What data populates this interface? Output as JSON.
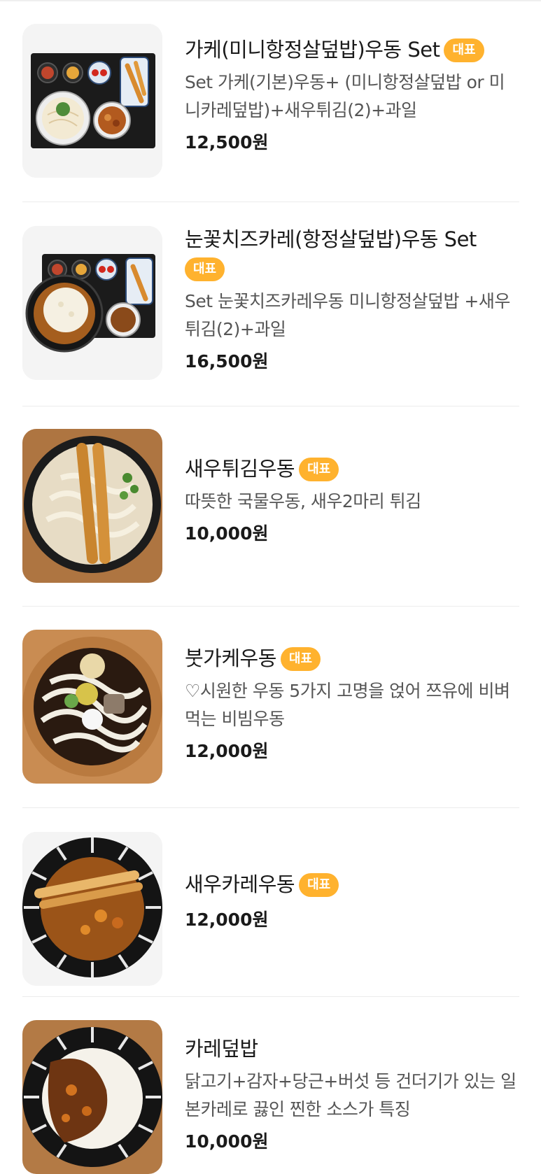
{
  "menu": {
    "items": [
      {
        "name": "가케(미니항정살덮밥)우동 Set",
        "badge": "대표",
        "description": "Set 가케(기본)우동+ (미니항정살덮밥 or 미니카레덮밥)+새우튀김(2)+과일",
        "price": "12,500원",
        "image_icon": "set-tray-food-image"
      },
      {
        "name": "눈꽃치즈카레(항정살덮밥)우동 Set",
        "badge": "대표",
        "description": "Set 눈꽃치즈카레우동 미니항정살덮밥 +새우튀김(2)+과일",
        "price": "16,500원",
        "image_icon": "set-tray-curry-food-image"
      },
      {
        "name": "새우튀김우동",
        "badge": "대표",
        "description": "따뜻한 국물우동, 새우2마리 튀김",
        "price": "10,000원",
        "image_icon": "shrimp-udon-image"
      },
      {
        "name": "붓가케우동",
        "badge": "대표",
        "description": "♡시원한 우동 5가지 고명을 얹어 쯔유에 비벼먹는 비빔우동",
        "price": "12,000원",
        "image_icon": "bukkake-udon-image"
      },
      {
        "name": "새우카레우동",
        "badge": "대표",
        "description": "",
        "price": "12,000원",
        "image_icon": "shrimp-curry-udon-image"
      },
      {
        "name": "카레덮밥",
        "badge": "",
        "description": "닭고기+감자+당근+버섯 등 건더기가 있는 일본카레로 끓인 찐한 소스가 특징",
        "price": "10,000원",
        "image_icon": "curry-rice-image"
      }
    ]
  },
  "colors": {
    "badge": "#ffb22e",
    "divider": "#ececec",
    "price": "#1a1a1a",
    "description": "#555555"
  }
}
